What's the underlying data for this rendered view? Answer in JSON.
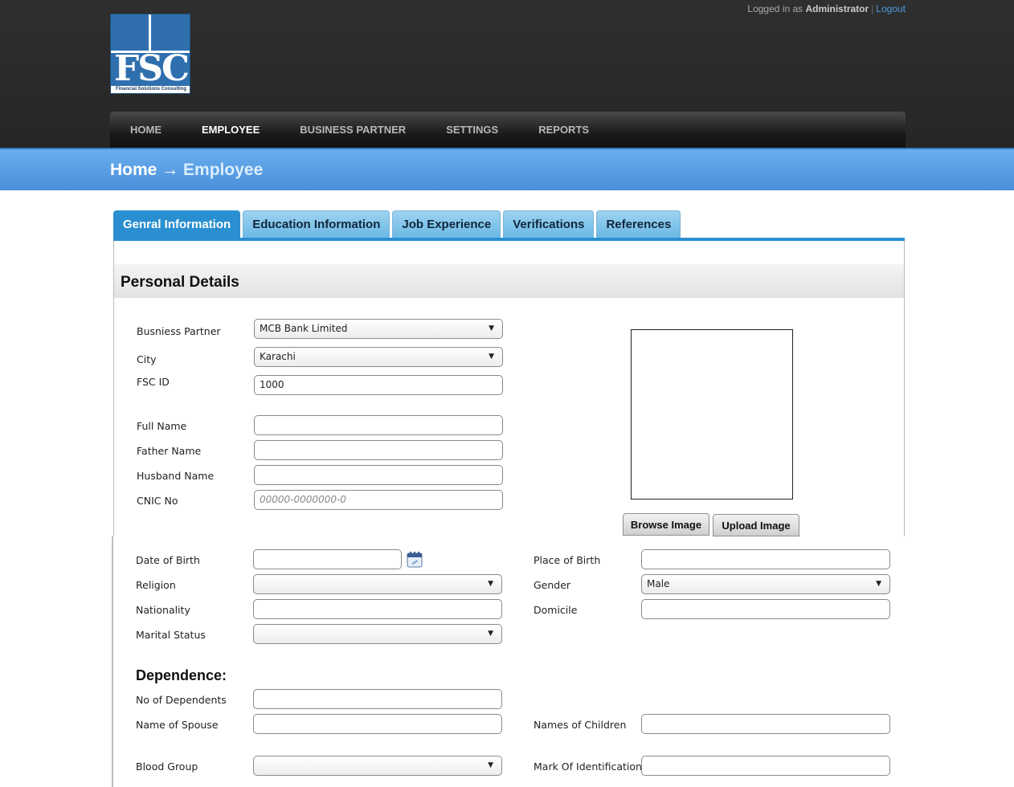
{
  "header": {
    "logo_text": "FSC",
    "logo_subtitle": "Financial Solutions Consulting",
    "logged_in_prefix": "Logged in as",
    "user": "Administrator",
    "separator": "|",
    "logout": "Logout"
  },
  "nav": {
    "items": [
      "HOME",
      "EMPLOYEE",
      "BUSINESS PARTNER",
      "SETTINGS",
      "REPORTS"
    ],
    "active": "EMPLOYEE"
  },
  "breadcrumb": {
    "home": "Home",
    "arrow": "→",
    "current": "Employee"
  },
  "tabs": [
    "Genral Information",
    "Education Information",
    "Job Experience",
    "Verifications",
    "References"
  ],
  "section_title": "Personal Details",
  "form": {
    "business_partner": {
      "label": "Busniess Partner",
      "value": "MCB Bank Limited"
    },
    "city": {
      "label": "City",
      "value": "Karachi"
    },
    "fsc_id": {
      "label": "FSC ID",
      "value": "1000"
    },
    "full_name": {
      "label": "Full Name",
      "value": ""
    },
    "father_name": {
      "label": "Father Name",
      "value": ""
    },
    "husband_name": {
      "label": "Husband Name",
      "value": ""
    },
    "cnic": {
      "label": "CNIC No",
      "placeholder": "00000-0000000-0"
    },
    "dob": {
      "label": "Date of Birth",
      "value": ""
    },
    "religion": {
      "label": "Religion",
      "value": ""
    },
    "nationality": {
      "label": "Nationality",
      "value": ""
    },
    "marital_status": {
      "label": "Marital Status",
      "value": ""
    },
    "place_of_birth": {
      "label": "Place of Birth",
      "value": ""
    },
    "gender": {
      "label": "Gender",
      "value": "Male"
    },
    "domicile": {
      "label": "Domicile",
      "value": ""
    },
    "dependence_title": "Dependence:",
    "no_of_dependents": {
      "label": "No of Dependents",
      "value": ""
    },
    "name_of_spouse": {
      "label": "Name of Spouse",
      "value": ""
    },
    "names_of_children": {
      "label": "Names of Children",
      "value": ""
    },
    "blood_group": {
      "label": "Blood Group",
      "value": ""
    },
    "mark_of_identification": {
      "label": "Mark Of Identification",
      "value": ""
    }
  },
  "photo": {
    "browse": "Browse Image",
    "upload": "Upload Image"
  },
  "colors": {
    "accent": "#2a8fd0",
    "band": "#5a9fe4",
    "header_bg": "#2b2b2b"
  }
}
